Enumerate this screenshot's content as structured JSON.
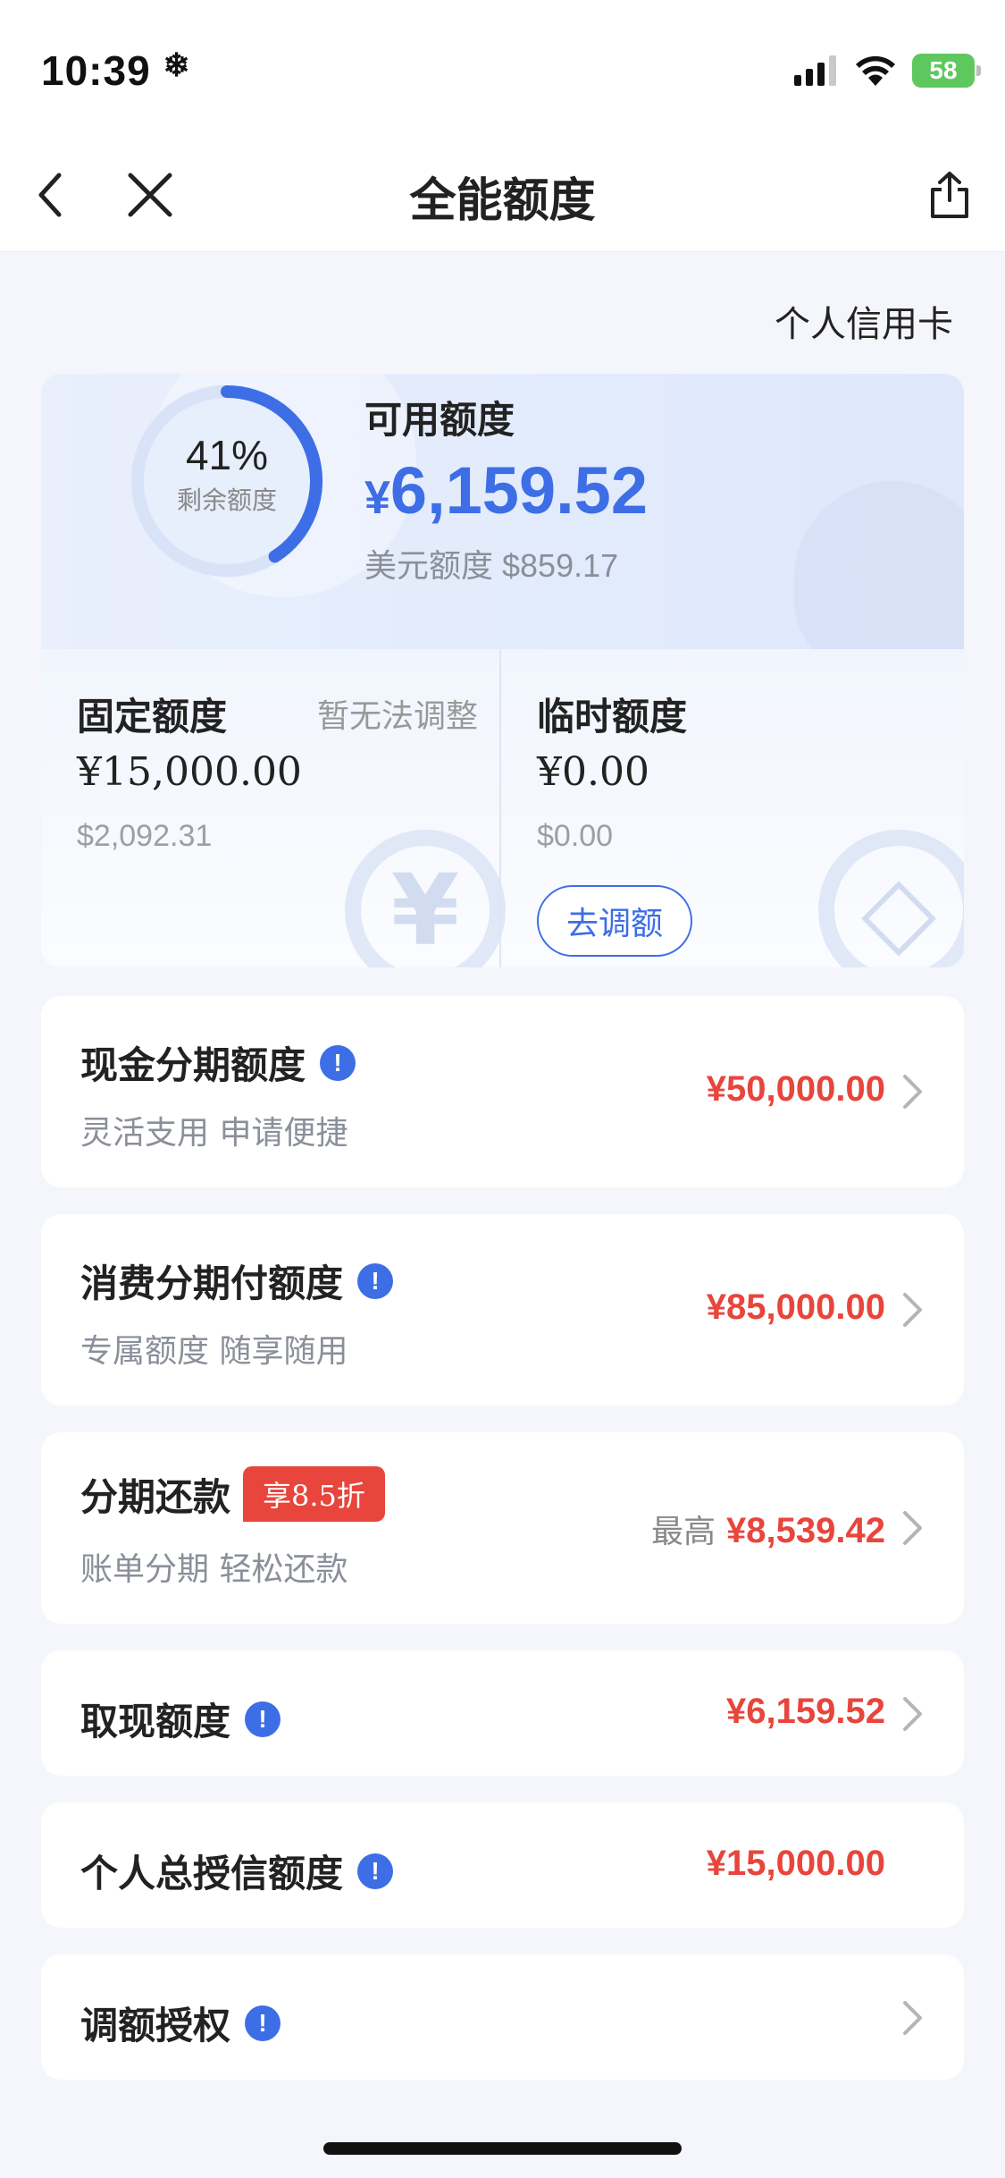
{
  "status_bar": {
    "time": "10:39",
    "battery": "58"
  },
  "nav": {
    "title": "全能额度"
  },
  "card_type": "个人信用卡",
  "summary": {
    "remaining_percent": 41,
    "remaining_percent_text": "41%",
    "remaining_label": "剩余额度",
    "available_label": "可用额度",
    "available_currency": "¥",
    "available_amount": "6,159.52",
    "usd_label": "美元额度",
    "usd_amount": "$859.17",
    "fixed": {
      "title": "固定额度",
      "note": "暂无法调整",
      "amount": "¥15,000.00",
      "usd": "$2,092.31"
    },
    "temporary": {
      "title": "临时额度",
      "amount": "¥0.00",
      "usd": "$0.00",
      "button": "去调额"
    }
  },
  "rows": {
    "cash_installment": {
      "title": "现金分期额度",
      "subtitle": "灵活支用 申请便捷",
      "value": "¥50,000.00"
    },
    "consumer_installment": {
      "title": "消费分期付额度",
      "subtitle": "专属额度 随享随用",
      "value": "¥85,000.00"
    },
    "installment_repay": {
      "title": "分期还款",
      "badge": "享8.5折",
      "subtitle": "账单分期 轻松还款",
      "prefix": "最高",
      "value": "¥8,539.42"
    },
    "cash_withdrawal": {
      "title": "取现额度",
      "value": "¥6,159.52"
    },
    "total_credit": {
      "title": "个人总授信额度",
      "value": "¥15,000.00"
    },
    "adjust_auth": {
      "title": "调额授权"
    }
  },
  "colors": {
    "accent_blue": "#3d6ee6",
    "amount_red": "#e8453c"
  }
}
